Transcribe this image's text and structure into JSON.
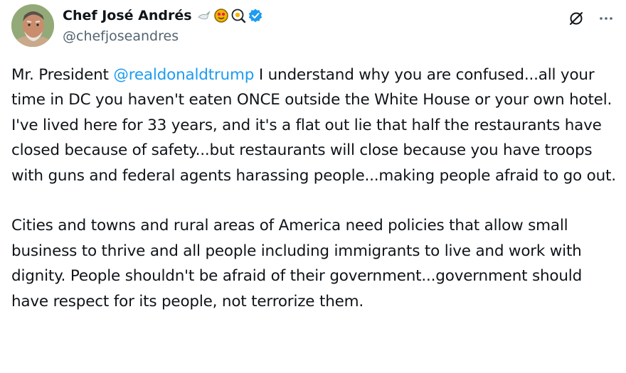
{
  "author": {
    "display_name": "Chef José Andrés",
    "handle": "@chefjoseandres",
    "verified": true,
    "name_emojis": [
      "dove-icon",
      "heart-eyes-face-icon",
      "fried-egg-icon",
      "magnifying-glass-icon"
    ]
  },
  "actions": {
    "grok_icon": "grok-slash-icon",
    "more_icon": "more-horizontal-icon"
  },
  "post": {
    "p1": {
      "before": "Mr. President ",
      "mention": "@realdonaldtrump",
      "after": " I understand why you are confused...all your time in DC you haven't eaten ONCE outside the White House or your own hotel. I've lived here for 33 years, and it's a flat out lie that half the restaurants have closed because of safety...but restaurants will close because you have troops with guns and federal agents harassing people...making people afraid to go out."
    },
    "p2": "Cities and towns and rural areas of America need policies that allow small business to thrive and all people including immigrants to live and work with dignity. People shouldn't be afraid of their government...government should have respect for its people, not terrorize them."
  },
  "colors": {
    "text": "#0f1419",
    "secondary": "#536471",
    "link": "#1d9bf0",
    "verified": "#1d9bf0"
  }
}
